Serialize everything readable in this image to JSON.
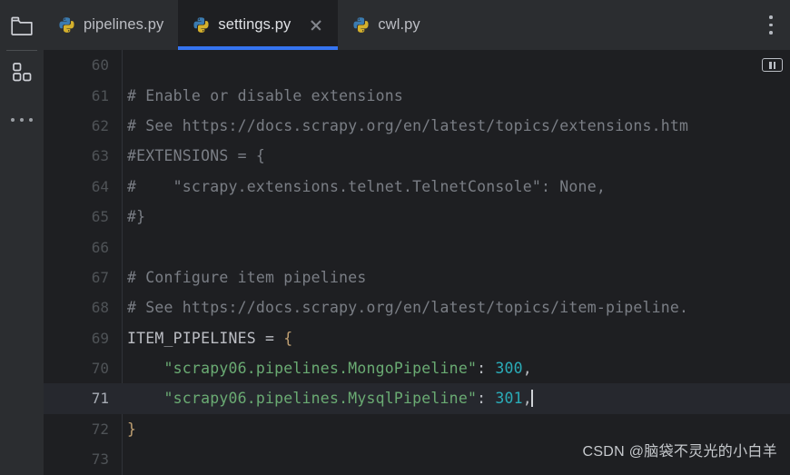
{
  "sidebar": {
    "items": [
      {
        "name": "project-folder",
        "icon": "folder-icon",
        "label": "Project"
      },
      {
        "name": "structure",
        "icon": "grid-squares-icon",
        "label": "Structure"
      },
      {
        "name": "more-tool-windows",
        "icon": "more-horizontal-icon",
        "label": "More tool windows"
      }
    ]
  },
  "tabbar": {
    "tabs": [
      {
        "label": "pipelines.py",
        "icon": "python-file-icon",
        "active": false,
        "closable": false
      },
      {
        "label": "settings.py",
        "icon": "python-file-icon",
        "active": true,
        "closable": true
      },
      {
        "label": "cwl.py",
        "icon": "python-file-icon",
        "active": false,
        "closable": false
      }
    ],
    "overflow_icon": "more-vertical-icon",
    "active_tab_underline_color": "#3574f0"
  },
  "editor": {
    "first_line": 60,
    "current_line": 71,
    "inspections_widget_icon": "inspections-widget-icon",
    "colors": {
      "background": "#1e1f22",
      "current_line_background": "#26282e",
      "gutter_text": "#4f5357",
      "comment": "#7a7e85",
      "string": "#6aab73",
      "number": "#2aacb8",
      "identifier": "#bcbec4",
      "brace": "#c0a072"
    },
    "lines": [
      {
        "n": 60,
        "tokens": []
      },
      {
        "n": 61,
        "tokens": [
          {
            "t": "cmt",
            "v": "# Enable or disable extensions"
          }
        ]
      },
      {
        "n": 62,
        "tokens": [
          {
            "t": "cmt",
            "v": "# See https://docs.scrapy.org/en/latest/topics/extensions.htm"
          }
        ]
      },
      {
        "n": 63,
        "tokens": [
          {
            "t": "cmt",
            "v": "#EXTENSIONS = {"
          }
        ]
      },
      {
        "n": 64,
        "tokens": [
          {
            "t": "cmt",
            "v": "#    \"scrapy.extensions.telnet.TelnetConsole\": None,"
          }
        ]
      },
      {
        "n": 65,
        "tokens": [
          {
            "t": "cmt",
            "v": "#}"
          }
        ]
      },
      {
        "n": 66,
        "tokens": []
      },
      {
        "n": 67,
        "tokens": [
          {
            "t": "cmt",
            "v": "# Configure item pipelines"
          }
        ]
      },
      {
        "n": 68,
        "tokens": [
          {
            "t": "cmt",
            "v": "# See https://docs.scrapy.org/en/latest/topics/item-pipeline."
          }
        ]
      },
      {
        "n": 69,
        "tokens": [
          {
            "t": "id",
            "v": "ITEM_PIPELINES"
          },
          {
            "t": "pun",
            "v": " = "
          },
          {
            "t": "brc",
            "v": "{"
          }
        ]
      },
      {
        "n": 70,
        "tokens": [
          {
            "t": "str",
            "v": "    \"scrapy06.pipelines.MongoPipeline\""
          },
          {
            "t": "pun",
            "v": ": "
          },
          {
            "t": "num",
            "v": "300"
          },
          {
            "t": "pun",
            "v": ","
          }
        ]
      },
      {
        "n": 71,
        "tokens": [
          {
            "t": "str",
            "v": "    \"scrapy06.pipelines.MysqlPipeline\""
          },
          {
            "t": "pun",
            "v": ": "
          },
          {
            "t": "num",
            "v": "301"
          },
          {
            "t": "pun",
            "v": ","
          },
          {
            "t": "caret",
            "v": ""
          }
        ]
      },
      {
        "n": 72,
        "tokens": [
          {
            "t": "brc",
            "v": "}"
          }
        ]
      },
      {
        "n": 73,
        "tokens": []
      }
    ]
  },
  "watermark": {
    "text": "CSDN @脑袋不灵光的小白羊"
  }
}
